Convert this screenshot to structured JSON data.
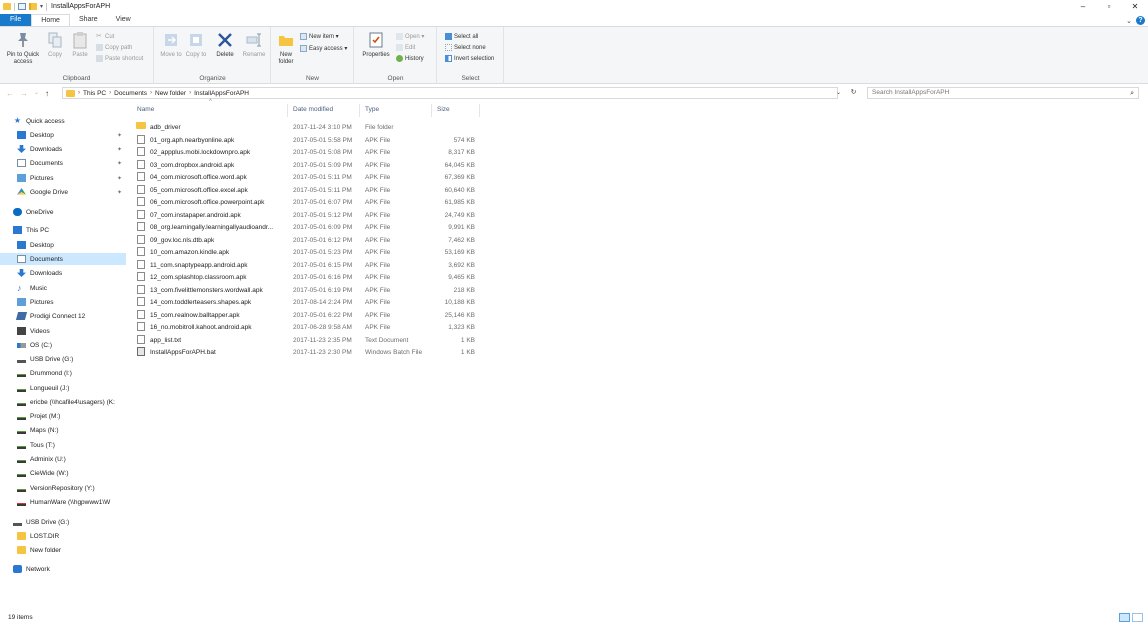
{
  "window": {
    "title": "InstallAppsForAPH",
    "controls": {
      "minimize": "–",
      "maximize": "▫",
      "close": "✕"
    }
  },
  "ribbon_tabs": [
    {
      "label": "File"
    },
    {
      "label": "Home"
    },
    {
      "label": "Share"
    },
    {
      "label": "View"
    }
  ],
  "ribbon": {
    "clipboard": {
      "label": "Clipboard",
      "pin_label": "Pin to Quick access",
      "copy_label": "Copy",
      "paste_label": "Paste",
      "cut_label": "Cut",
      "copy_path_label": "Copy path",
      "paste_shortcut_label": "Paste shortcut"
    },
    "organize": {
      "label": "Organize",
      "move_label": "Move to",
      "copyto_label": "Copy to",
      "delete_label": "Delete",
      "rename_label": "Rename"
    },
    "new": {
      "label": "New",
      "new_folder_label": "New folder",
      "new_item_label": "New item ▾",
      "easy_access_label": "Easy access ▾"
    },
    "open": {
      "label": "Open",
      "properties_label": "Properties",
      "open_label": "Open ▾",
      "edit_label": "Edit",
      "history_label": "History"
    },
    "select": {
      "label": "Select",
      "select_all_label": "Select all",
      "select_none_label": "Select none",
      "invert_label": "Invert selection"
    }
  },
  "address": {
    "crumbs": [
      "This PC",
      "Documents",
      "New folder",
      "InstallAppsForAPH"
    ],
    "search_placeholder": "Search InstallAppsForAPH"
  },
  "nav_pane": {
    "items": [
      {
        "label": "Quick access",
        "icon": "star-icon",
        "indent": 0,
        "pinned": false
      },
      {
        "label": "Desktop",
        "icon": "desktop-icon",
        "indent": 1,
        "pinned": true
      },
      {
        "label": "Downloads",
        "icon": "downloads-icon",
        "indent": 1,
        "pinned": true
      },
      {
        "label": "Documents",
        "icon": "documents-icon",
        "indent": 1,
        "pinned": true
      },
      {
        "label": "Pictures",
        "icon": "pictures-icon",
        "indent": 1,
        "pinned": true
      },
      {
        "label": "Google Drive",
        "icon": "google-drive-icon",
        "indent": 1,
        "pinned": true
      },
      {
        "label": "OneDrive",
        "icon": "onedrive-icon",
        "indent": 0,
        "pinned": false
      },
      {
        "label": "This PC",
        "icon": "this-pc-icon",
        "indent": 0,
        "pinned": false
      },
      {
        "label": "Desktop",
        "icon": "desktop-icon",
        "indent": 1,
        "pinned": false
      },
      {
        "label": "Documents",
        "icon": "documents-icon",
        "indent": 1,
        "pinned": false,
        "selected": true
      },
      {
        "label": "Downloads",
        "icon": "downloads-icon",
        "indent": 1,
        "pinned": false
      },
      {
        "label": "Music",
        "icon": "music-icon",
        "indent": 1,
        "pinned": false
      },
      {
        "label": "Pictures",
        "icon": "pictures-icon",
        "indent": 1,
        "pinned": false
      },
      {
        "label": "Prodigi Connect 12",
        "icon": "device-icon",
        "indent": 1,
        "pinned": false
      },
      {
        "label": "Videos",
        "icon": "videos-icon",
        "indent": 1,
        "pinned": false
      },
      {
        "label": "OS (C:)",
        "icon": "os-drive-icon",
        "indent": 1,
        "pinned": false
      },
      {
        "label": "USB Drive (G:)",
        "icon": "usb-drive-icon",
        "indent": 1,
        "pinned": false
      },
      {
        "label": "Drummond (I:)",
        "icon": "network-drive-icon",
        "indent": 1,
        "pinned": false
      },
      {
        "label": "Longueuil (J:)",
        "icon": "network-drive-icon",
        "indent": 1,
        "pinned": false
      },
      {
        "label": "ericbe (\\\\hcafile4\\usagers) (K:",
        "icon": "network-drive-icon",
        "indent": 1,
        "pinned": false
      },
      {
        "label": "Projet (M:)",
        "icon": "network-drive-icon",
        "indent": 1,
        "pinned": false
      },
      {
        "label": "Maps (N:)",
        "icon": "network-drive-icon",
        "indent": 1,
        "pinned": false
      },
      {
        "label": "Tous (T:)",
        "icon": "network-drive-icon",
        "indent": 1,
        "pinned": false
      },
      {
        "label": "Adminix (U:)",
        "icon": "network-drive-icon",
        "indent": 1,
        "pinned": false
      },
      {
        "label": "CieWide (W:)",
        "icon": "network-drive-icon",
        "indent": 1,
        "pinned": false
      },
      {
        "label": "VersionRepository (Y:)",
        "icon": "network-drive-icon",
        "indent": 1,
        "pinned": false
      },
      {
        "label": "HumanWare (\\\\hgpwww1\\W",
        "icon": "network-drive-error-icon",
        "indent": 1,
        "pinned": false
      },
      {
        "label": "USB Drive (G:)",
        "icon": "usb-drive-icon",
        "indent": 0,
        "pinned": false
      },
      {
        "label": "LOST.DIR",
        "icon": "folder-icon",
        "indent": 1,
        "pinned": false
      },
      {
        "label": "New folder",
        "icon": "folder-icon",
        "indent": 1,
        "pinned": false
      },
      {
        "label": "Network",
        "icon": "network-icon",
        "indent": 0,
        "pinned": false
      }
    ]
  },
  "file_list": {
    "columns": {
      "name": "Name",
      "date": "Date modified",
      "type": "Type",
      "size": "Size"
    },
    "rows": [
      {
        "name": "adb_driver",
        "date": "2017-11-24 3:10 PM",
        "type": "File folder",
        "size": "",
        "kind": "folder"
      },
      {
        "name": "01_org.aph.nearbyonline.apk",
        "date": "2017-05-01 5:58 PM",
        "type": "APK File",
        "size": "574 KB",
        "kind": "doc"
      },
      {
        "name": "02_appplus.mobi.lockdownpro.apk",
        "date": "2017-05-01 5:08 PM",
        "type": "APK File",
        "size": "8,317 KB",
        "kind": "doc"
      },
      {
        "name": "03_com.dropbox.android.apk",
        "date": "2017-05-01 5:09 PM",
        "type": "APK File",
        "size": "64,045 KB",
        "kind": "doc"
      },
      {
        "name": "04_com.microsoft.office.word.apk",
        "date": "2017-05-01 5:11 PM",
        "type": "APK File",
        "size": "67,369 KB",
        "kind": "doc"
      },
      {
        "name": "05_com.microsoft.office.excel.apk",
        "date": "2017-05-01 5:11 PM",
        "type": "APK File",
        "size": "60,640 KB",
        "kind": "doc"
      },
      {
        "name": "06_com.microsoft.office.powerpoint.apk",
        "date": "2017-05-01 6:07 PM",
        "type": "APK File",
        "size": "61,985 KB",
        "kind": "doc"
      },
      {
        "name": "07_com.instapaper.android.apk",
        "date": "2017-05-01 5:12 PM",
        "type": "APK File",
        "size": "24,749 KB",
        "kind": "doc"
      },
      {
        "name": "08_org.learningally.learningallyaudioandr...",
        "date": "2017-05-01 6:09 PM",
        "type": "APK File",
        "size": "9,991 KB",
        "kind": "doc"
      },
      {
        "name": "09_gov.loc.nls.dtb.apk",
        "date": "2017-05-01 6:12 PM",
        "type": "APK File",
        "size": "7,462 KB",
        "kind": "doc"
      },
      {
        "name": "10_com.amazon.kindle.apk",
        "date": "2017-05-01 5:23 PM",
        "type": "APK File",
        "size": "53,169 KB",
        "kind": "doc"
      },
      {
        "name": "11_com.snaptypeapp.android.apk",
        "date": "2017-05-01 6:15 PM",
        "type": "APK File",
        "size": "3,692 KB",
        "kind": "doc"
      },
      {
        "name": "12_com.splashtop.classroom.apk",
        "date": "2017-05-01 6:16 PM",
        "type": "APK File",
        "size": "9,465 KB",
        "kind": "doc"
      },
      {
        "name": "13_com.fivelittlemonsters.wordwall.apk",
        "date": "2017-05-01 6:19 PM",
        "type": "APK File",
        "size": "218 KB",
        "kind": "doc"
      },
      {
        "name": "14_com.toddlerteasers.shapes.apk",
        "date": "2017-08-14 2:24 PM",
        "type": "APK File",
        "size": "10,188 KB",
        "kind": "doc"
      },
      {
        "name": "15_com.realnow.balltapper.apk",
        "date": "2017-05-01 6:22 PM",
        "type": "APK File",
        "size": "25,146 KB",
        "kind": "doc"
      },
      {
        "name": "16_no.mobitroll.kahoot.android.apk",
        "date": "2017-06-28 9:58 AM",
        "type": "APK File",
        "size": "1,323 KB",
        "kind": "doc"
      },
      {
        "name": "app_list.txt",
        "date": "2017-11-23 2:35 PM",
        "type": "Text Document",
        "size": "1 KB",
        "kind": "doc"
      },
      {
        "name": "InstallAppsForAPH.bat",
        "date": "2017-11-23 2:30 PM",
        "type": "Windows Batch File",
        "size": "1 KB",
        "kind": "bat"
      }
    ]
  },
  "status": {
    "item_count": "19 items"
  },
  "colors": {
    "accent": "#1979ca",
    "selection": "#cce8ff",
    "folder": "#f5c542"
  }
}
